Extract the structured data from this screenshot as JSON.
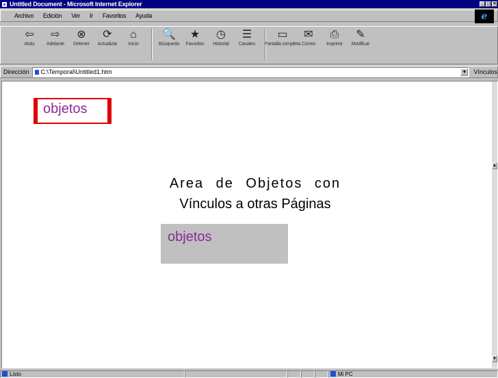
{
  "window": {
    "title": "Untitled Document - Microsoft Internet Explorer",
    "buttons": [
      "_",
      "□",
      "×"
    ]
  },
  "menubar": {
    "items": [
      "Archivo",
      "Edición",
      "Ver",
      "Ir",
      "Favoritos",
      "Ayuda"
    ]
  },
  "toolbar": {
    "buttons": [
      {
        "label": "Atrás",
        "icon": "back-arrow-icon",
        "glyph": "⇦"
      },
      {
        "label": "Adelante",
        "icon": "forward-arrow-icon",
        "glyph": "⇨"
      },
      {
        "label": "Detener",
        "icon": "stop-icon",
        "glyph": "⊗"
      },
      {
        "label": "Actualizar",
        "icon": "refresh-icon",
        "glyph": "⟳"
      },
      {
        "label": "Inicio",
        "icon": "home-icon",
        "glyph": "⌂"
      },
      {
        "label": "Búsqueda",
        "icon": "search-icon",
        "glyph": "🔍"
      },
      {
        "label": "Favoritos",
        "icon": "favorites-icon",
        "glyph": "★"
      },
      {
        "label": "Historial",
        "icon": "history-icon",
        "glyph": "◷"
      },
      {
        "label": "Canales",
        "icon": "channels-icon",
        "glyph": "☰"
      },
      {
        "label": "Pantalla completa",
        "icon": "fullscreen-icon",
        "glyph": "▭"
      },
      {
        "label": "Correo",
        "icon": "mail-icon",
        "glyph": "✉"
      },
      {
        "label": "Imprimir",
        "icon": "print-icon",
        "glyph": "⎙"
      },
      {
        "label": "Modificar",
        "icon": "edit-icon",
        "glyph": "✎"
      }
    ]
  },
  "addressbar": {
    "label": "Dirección",
    "value": "C:\\Temporal\\Untitled1.htm",
    "links_label": "Vínculos"
  },
  "page": {
    "top_box_text": "objetos",
    "heading_line1": "Area de Objetos con",
    "heading_line2": "Vínculos a otras Páginas",
    "mid_box_text": "objetos"
  },
  "statusbar": {
    "text": "Listo",
    "zone": "Mi PC"
  },
  "colors": {
    "titlebar": "#000080",
    "chrome": "#c0c0c0",
    "link_text": "#8a2a9a",
    "red_border": "#e00000"
  }
}
